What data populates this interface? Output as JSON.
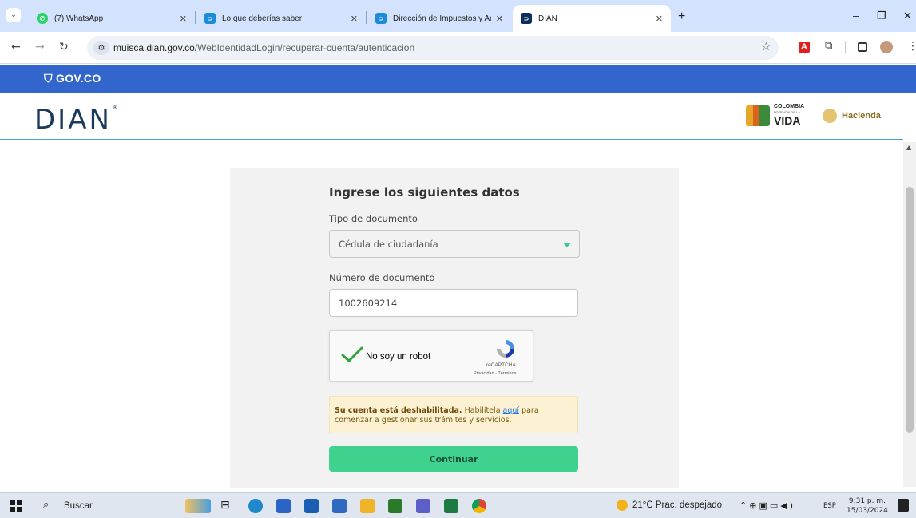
{
  "browser": {
    "tabs": [
      {
        "title": "(7) WhatsApp",
        "close": "✕",
        "icon": "whatsapp-icon"
      },
      {
        "title": "Lo que deberías saber",
        "close": "✕",
        "icon": "dian-icon"
      },
      {
        "title": "Dirección de Impuestos y Adua",
        "close": "✕",
        "icon": "dian-icon"
      },
      {
        "title": "DIAN",
        "close": "✕",
        "icon": "dian-icon",
        "active": true
      }
    ],
    "new_tab": "+",
    "window_controls": {
      "minimize": "–",
      "restore": "❐",
      "close": "✕"
    },
    "url_host": "muisca.dian.gov.co",
    "url_path": "/WebIdentidadLogin/recuperar-cuenta/autenticacion"
  },
  "gov_bar": {
    "logo": "GOV.CO",
    "color": "#3366cc"
  },
  "header": {
    "dian_logo": "DIAN",
    "colombia_line1": "COLOMBIA",
    "colombia_line2": "POTENCIA DE LA",
    "colombia_line3": "VIDA",
    "hacienda": "Hacienda"
  },
  "form": {
    "title": "Ingrese los siguientes datos",
    "doc_type_label": "Tipo de documento",
    "doc_type_value": "Cédula de ciudadanía",
    "doc_number_label": "Número de documento",
    "doc_number_value": "1002609214",
    "captcha_text": "No soy un robot",
    "captcha_brand": "reCAPTCHA",
    "captcha_links": "Privacidad - Términos",
    "alert_bold": "Su cuenta está deshabilitada.",
    "alert_text1": " Habilítela ",
    "alert_link": "aquí",
    "alert_text2": " para comenzar a gestionar sus trámites y servicios.",
    "submit_label": "Continuar",
    "accent_color": "#3fd18e"
  },
  "taskbar": {
    "search_label": "Buscar",
    "weather": "21°C  Prac. despejado",
    "language": "ESP",
    "time": "9:31 p. m.",
    "date": "15/03/2024"
  }
}
